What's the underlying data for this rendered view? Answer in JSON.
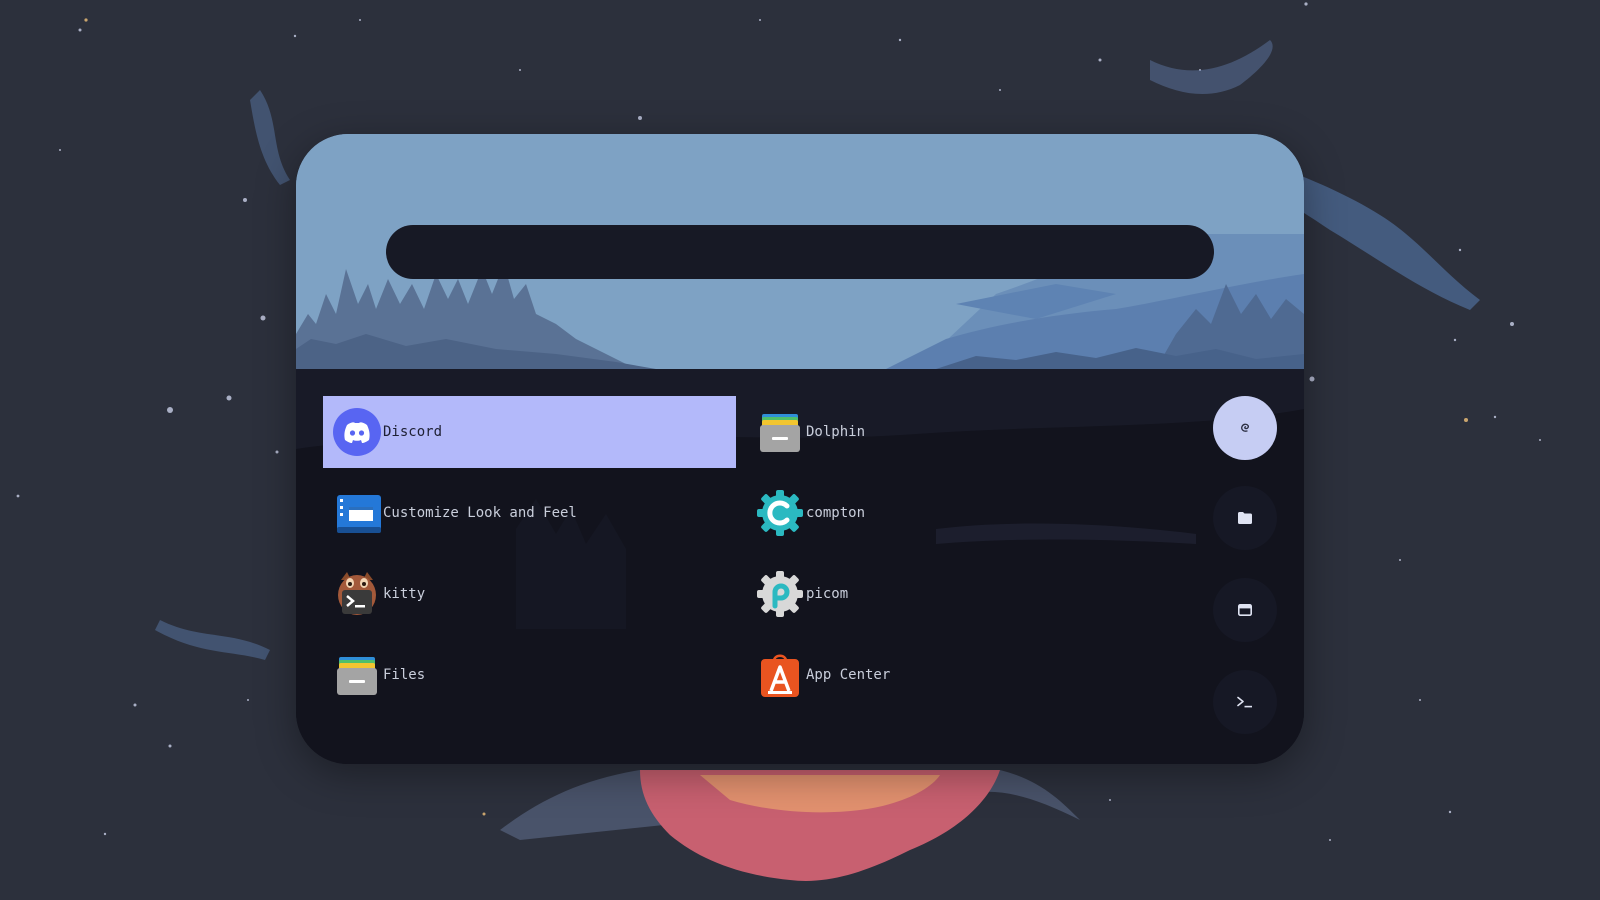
{
  "search": {
    "value": "",
    "placeholder": ""
  },
  "apps": [
    {
      "label": "Discord",
      "icon": "discord-icon",
      "selected": true
    },
    {
      "label": "Dolphin",
      "icon": "dolphin-icon",
      "selected": false
    },
    {
      "label": "Customize Look and Feel",
      "icon": "customize-look-icon",
      "selected": false
    },
    {
      "label": "compton",
      "icon": "compton-icon",
      "selected": false
    },
    {
      "label": "kitty",
      "icon": "kitty-icon",
      "selected": false
    },
    {
      "label": "picom",
      "icon": "picom-icon",
      "selected": false
    },
    {
      "label": "Files",
      "icon": "files-icon",
      "selected": false
    },
    {
      "label": "App Center",
      "icon": "app-center-icon",
      "selected": false
    }
  ],
  "side_modes": [
    {
      "icon": "debian-swirl-icon",
      "active": true
    },
    {
      "icon": "folder-icon",
      "active": false
    },
    {
      "icon": "window-icon",
      "active": false
    },
    {
      "icon": "terminal-prompt-icon",
      "active": false
    }
  ],
  "colors": {
    "background": "#2c303c",
    "hero_sky": "#7ea2c4",
    "panel": "#12131d",
    "search_bar": "#171925",
    "selection": "#b3b9fa",
    "active_mode": "#c6cdf3",
    "text": "#c9cedb"
  }
}
